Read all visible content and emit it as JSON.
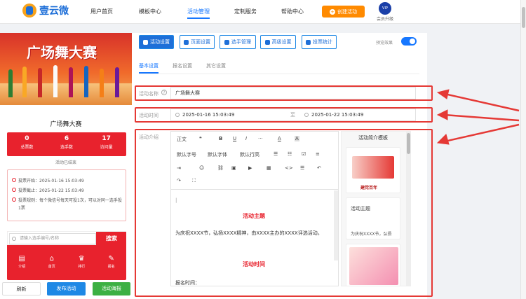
{
  "header": {
    "brand": "壹云微",
    "nav": [
      "用户首页",
      "模板中心",
      "活动管理",
      "定制服务",
      "帮助中心"
    ],
    "active_nav": "活动管理",
    "create_button": "创建活动",
    "vip_badge": "VIP",
    "vip_label": "会员升级"
  },
  "preview": {
    "banner_title": "广场舞大赛",
    "event_name": "广场舞大赛",
    "stats": [
      {
        "value": "0",
        "label": "总票数"
      },
      {
        "value": "6",
        "label": "选手数"
      },
      {
        "value": "17",
        "label": "访问量"
      }
    ],
    "status": "活动已结束",
    "info": [
      "投票开始：2025-01-16 15:03:49",
      "投票截止：2025-01-22 15:03:49",
      "投票规则：每个微信号每天可投1次，可以对同一选手投1票"
    ],
    "search_placeholder": "请输入选手编号/名称",
    "search_button": "搜索",
    "tabs": [
      "介绍",
      "首页",
      "排行",
      "报名"
    ],
    "buttons": {
      "refresh": "刷新",
      "publish": "发布活动",
      "publish_poster": "活动海报"
    }
  },
  "toolbar": {
    "buttons": [
      "活动设置",
      "页面设置",
      "选手管理",
      "高级设置",
      "投票统计"
    ],
    "preview_label": "预览效果"
  },
  "subtabs": [
    "基本设置",
    "报名设置",
    "其它设置"
  ],
  "form": {
    "name_label": "活动名称",
    "name_value": "广场舞大赛",
    "time_label": "活动时间",
    "start": "2025-01-16 15:03:49",
    "to": "至",
    "end": "2025-01-22 15:03:49",
    "intro_label": "活动介绍"
  },
  "editor": {
    "toolbar_row1": [
      "正文",
      "❝",
      "B",
      "U",
      "I",
      "···",
      "A",
      "A"
    ],
    "toolbar_row2": [
      "默认字号",
      "默认字体",
      "默认行高",
      "☰",
      "☷",
      "☑",
      "≡"
    ],
    "toolbar_row3": [
      "⇥",
      "☺",
      "⛓",
      "▣",
      "▶",
      "▦",
      "<>",
      "☰",
      "↶"
    ],
    "toolbar_row4": [
      "↷",
      "⛶"
    ],
    "heading1": "活动主题",
    "body1": "为庆祝XXXX节，弘扬XXXX精神，由XXXX主办的XXXX评选活动。",
    "heading2": "活动时间",
    "body2": "报名时间："
  },
  "template_panel": {
    "title": "活动简介模板",
    "card1_text": "建党百年",
    "card2_title": "活动主题",
    "card2_text": "为庆祝XXXX节，弘扬"
  },
  "colors": {
    "accent": "#1677ff",
    "red": "#e8222d",
    "orange": "#ff8a00"
  }
}
